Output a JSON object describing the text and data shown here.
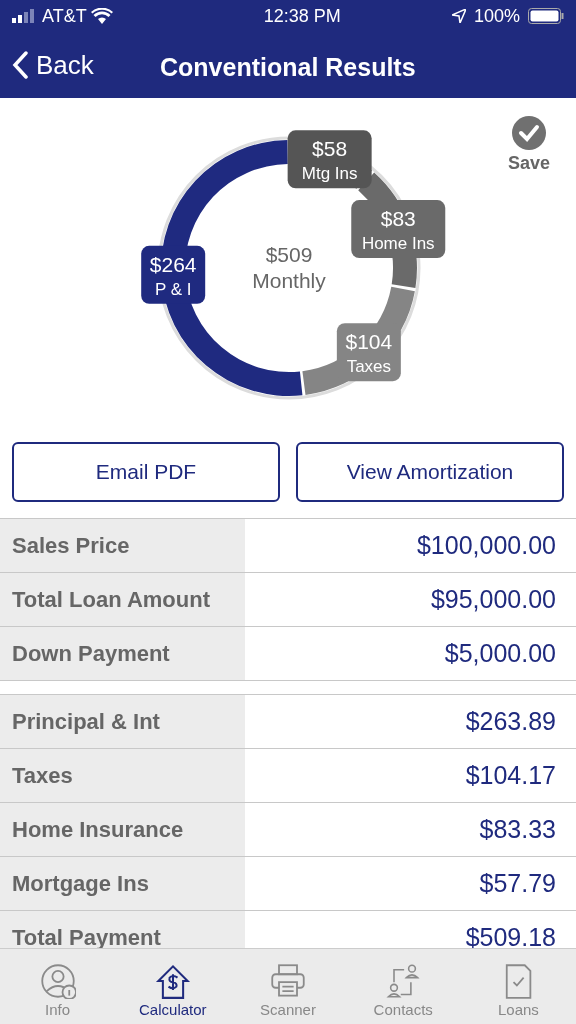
{
  "status_bar": {
    "carrier": "AT&T",
    "time": "12:38 PM",
    "battery": "100%"
  },
  "nav": {
    "back": "Back",
    "title": "Conventional Results"
  },
  "chart": {
    "center_amount": "$509",
    "center_label": "Monthly",
    "slices": [
      {
        "color": "#555555"
      },
      {
        "color": "#6a6a6a"
      },
      {
        "color": "#858585"
      },
      {
        "color": "#1f2a80"
      }
    ],
    "chart_data": {
      "type": "donut",
      "categories": [
        "Mtg Ins",
        "Home Ins",
        "Taxes",
        "P & I"
      ],
      "values": [
        58,
        83,
        104,
        264
      ],
      "value_labels": [
        "$58",
        "$83",
        "$104",
        "$264"
      ]
    }
  },
  "save": {
    "label": "Save"
  },
  "buttons": [
    "Email PDF",
    "View Amortization"
  ],
  "loan_rows": [
    {
      "label": "Sales Price",
      "value": "$100,000.00"
    },
    {
      "label": "Total Loan Amount",
      "value": "$95,000.00"
    },
    {
      "label": "Down Payment",
      "value": "$5,000.00"
    }
  ],
  "payment_rows": [
    {
      "label": "Principal & Int",
      "value": "$263.89"
    },
    {
      "label": "Taxes",
      "value": "$104.17"
    },
    {
      "label": "Home Insurance",
      "value": "$83.33"
    },
    {
      "label": "Mortgage Ins",
      "value": "$57.79"
    },
    {
      "label": "Total Payment",
      "value": "$509.18"
    }
  ],
  "tabs": [
    {
      "label": "Info",
      "kind": "info",
      "selected": false
    },
    {
      "label": "Calculator",
      "kind": "calculator",
      "selected": true
    },
    {
      "label": "Scanner",
      "kind": "scanner",
      "selected": false
    },
    {
      "label": "Contacts",
      "kind": "contacts",
      "selected": false
    },
    {
      "label": "Loans",
      "kind": "loans",
      "selected": false
    }
  ]
}
